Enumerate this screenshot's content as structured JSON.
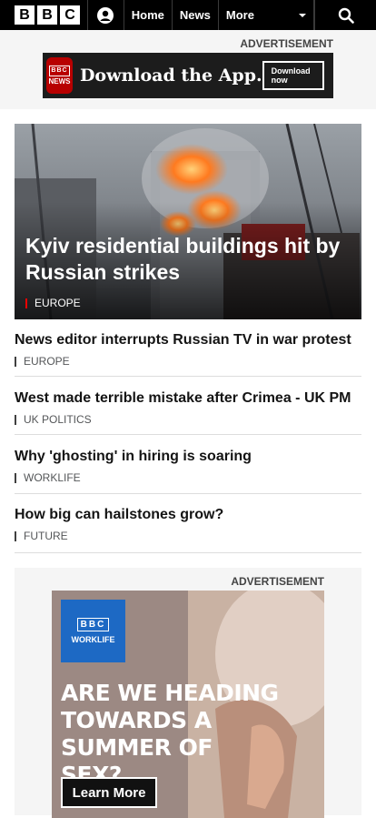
{
  "header": {
    "logo_letters": [
      "B",
      "B",
      "C"
    ],
    "nav": {
      "home": "Home",
      "news": "News",
      "more": "More"
    }
  },
  "top_ad": {
    "label": "ADVERTISEMENT",
    "logo_top": "BBC",
    "logo_bottom": "NEWS",
    "text": "Download the App.",
    "button": "Download now"
  },
  "hero": {
    "title": "Kyiv residential buildings hit by Russian strikes",
    "tag": "EUROPE"
  },
  "stories": [
    {
      "title": "News editor interrupts Russian TV in war protest",
      "tag": "EUROPE"
    },
    {
      "title": "West made terrible mistake after Crimea - UK PM",
      "tag": "UK POLITICS"
    },
    {
      "title": "Why 'ghosting' in hiring is soaring",
      "tag": "WORKLIFE"
    },
    {
      "title": "How big can hailstones grow?",
      "tag": "FUTURE"
    }
  ],
  "bottom_ad": {
    "label": "ADVERTISEMENT",
    "logo_top": "BBC",
    "logo_bottom": "WORKLIFE",
    "headline": "ARE WE HEADING TOWARDS A SUMMER OF SEX?",
    "button": "Learn More"
  },
  "colors": {
    "accent_red": "#b80000",
    "worklife_blue": "#1d69c4"
  }
}
